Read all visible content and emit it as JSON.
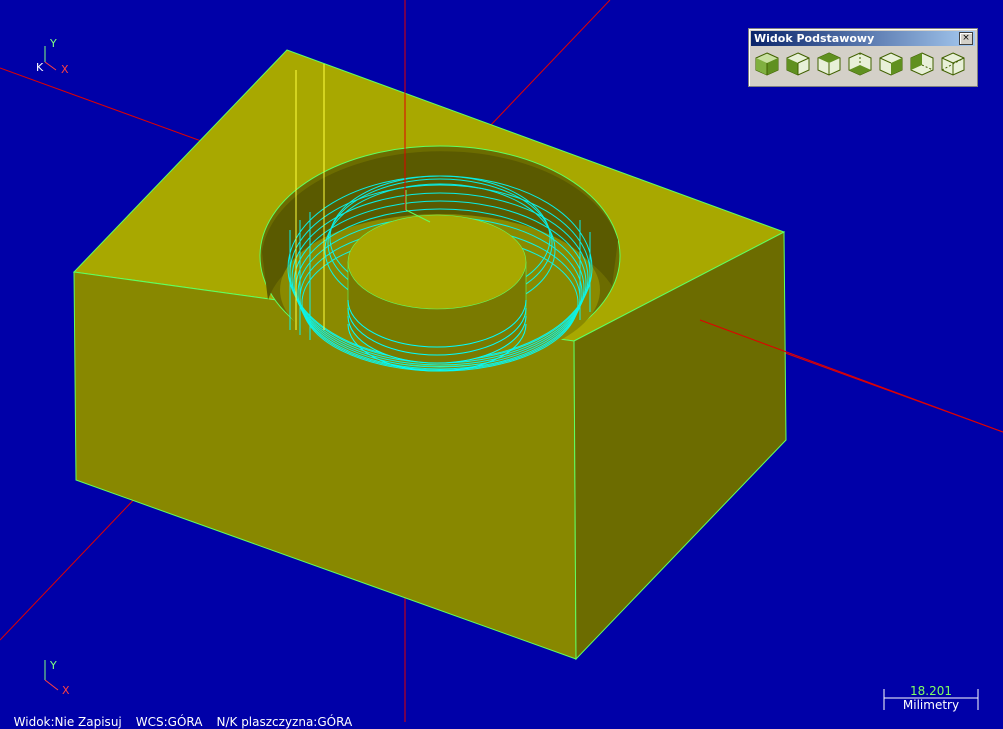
{
  "toolbar": {
    "title": "Widok Podstawowy",
    "close_label": "×",
    "buttons": [
      {
        "name": "view-iso-icon"
      },
      {
        "name": "view-front-icon"
      },
      {
        "name": "view-top-icon"
      },
      {
        "name": "view-bottom-icon"
      },
      {
        "name": "view-right-icon"
      },
      {
        "name": "view-left-icon"
      },
      {
        "name": "view-wire-icon"
      }
    ]
  },
  "axis_triad_top": {
    "y": "Y",
    "k": "K",
    "x": "X"
  },
  "axis_triad_bottom": {
    "y": "Y",
    "x": "X"
  },
  "status": {
    "view": "Widok:Nie Zapisuj",
    "wcs": "WCS:GÓRA",
    "plane": "N/K plaszczyzna:GÓRA"
  },
  "scale": {
    "value": "18.201",
    "unit": "Milimetry"
  },
  "colors": {
    "background": "#0000a8",
    "part_top": "#a8a800",
    "part_front": "#888800",
    "part_side": "#6c6c00",
    "toolpath": "#00ffff",
    "axis": "#e00000",
    "edge": "#60ff60"
  }
}
